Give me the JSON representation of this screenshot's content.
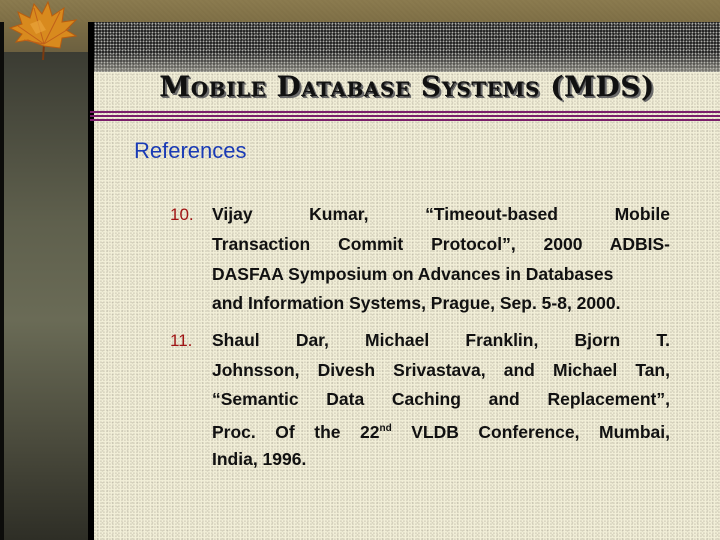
{
  "slide": {
    "title": "Mobile Database Systems (MDS)",
    "section_heading": "References",
    "references": [
      {
        "number": "10.",
        "lines": [
          "Vijay Kumar, “Timeout-based Mobile",
          "Transaction Commit Protocol”, 2000 ADBIS-",
          "DASFAA Symposium on Advances in Databases",
          "and Information Systems, Prague, Sep. 5-8, 2000."
        ]
      },
      {
        "number": "11.",
        "lines": [
          "Shaul Dar, Michael Franklin, Bjorn T.",
          "Johnsson, Divesh Srivastava, and Michael Tan,",
          "“Semantic Data Caching and Replacement”,",
          "Proc. Of the 22nd VLDB Conference, Mumbai,",
          "India, 1996."
        ],
        "line4_parts": {
          "before": "Proc. Of the 22",
          "sup": "nd",
          "after": " VLDB Conference, Mumbai,"
        }
      }
    ]
  },
  "decor": {
    "leaf_icon": "maple-leaf-icon",
    "colors": {
      "title_text": "#111111",
      "heading_blue": "#1a3bb5",
      "number_red": "#a01515",
      "rule_purple": "#7a1e6a",
      "slide_bg": "#f2efd8"
    }
  }
}
